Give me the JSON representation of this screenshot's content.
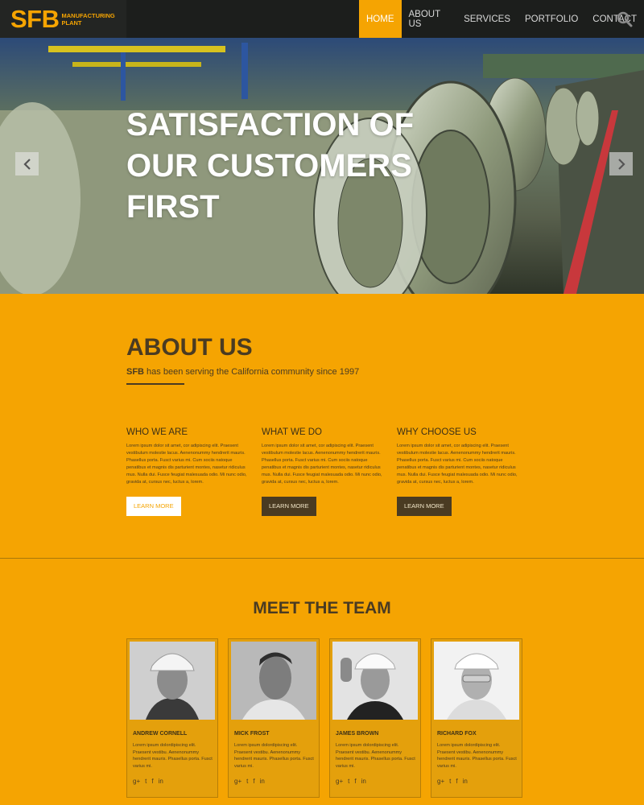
{
  "brand": {
    "logo_main": "SFB",
    "logo_sub": "MANUFACTURING PLANT",
    "accent": "#f5a402",
    "dark": "#1c1e1c",
    "text_brown": "#4a3b22"
  },
  "nav": {
    "items": [
      {
        "label": "HOME",
        "active": true
      },
      {
        "label": "ABOUT US",
        "active": false
      },
      {
        "label": "SERVICES",
        "active": false
      },
      {
        "label": "PORTFOLIO",
        "active": false
      },
      {
        "label": "CONTACT",
        "active": false
      }
    ],
    "search_icon": "search-icon"
  },
  "hero": {
    "title": "SATISFACTION OF OUR CUSTOMERS FIRST",
    "prev_icon": "chevron-left-icon",
    "next_icon": "chevron-right-icon"
  },
  "about": {
    "title": "ABOUT US",
    "subtitle_brand": "SFB",
    "subtitle_rest": " has been serving the California community since 1997",
    "columns": [
      {
        "heading": "WHO WE ARE",
        "body": "Lorem ipsum dolor sit amet, cor adipiscing elit. Praesent vestibulum molestie lacus. Aenenonummy hendrerit mauris. Phasellus porta. Fusct varius mi. Cum sociis natoque penatibus et magnis dis parturient montes, nasetur ridiculus mus. Nulla dui. Fusce feugiat malesuada odio. Mi nunc odio, gravida at, cursus nec, luctus a, lorem.",
        "button": "LEARN MORE",
        "style": "light"
      },
      {
        "heading": "WHAT WE DO",
        "body": "Lorem ipsum dolor sit amet, cor adipiscing elit. Praesent vestibulum molestie lacus. Aenenonummy hendrerit mauris. Phasellus porta. Fusct varius mi. Cum sociis natoque penatibus et magnis dis parturient montes, nasetur ridiculus mus. Nulla dui. Fusce feugiat malesuada odio. Mi nunc odio, gravida at, cursus nec, luctus a, lorem.",
        "button": "LEARN MORE",
        "style": "dark"
      },
      {
        "heading": "WHY CHOOSE US",
        "body": "Lorem ipsum dolor sit amet, cor adipiscing elit. Praesent vestibulum molestie lacus. Aenenonummy hendrerit mauris. Phasellus porta. Fusct varius mi. Cum sociis natoque penatibus et magnis dis parturient montes, nasetur ridiculus mus. Nulla dui. Fusce feugiat malesuada odio. Mi nunc odio, gravida at, cursus nec, luctus a, lorem.",
        "button": "LEARN MORE",
        "style": "dark"
      }
    ]
  },
  "team": {
    "title": "MEET THE TEAM",
    "members": [
      {
        "name": "ANDREW CORNELL",
        "bio": "Lorem ipsum dolordipiscing elit. Praesent vestibu. Aenenonummy hendrerit mauris. Phasellus porta. Fusct varius mi."
      },
      {
        "name": "MICK FROST",
        "bio": "Lorem ipsum dolordipiscing elit. Praesent vestibu. Aenenonummy hendrerit mauris. Phasellus porta. Fusct varius mi."
      },
      {
        "name": "JAMES BROWN",
        "bio": "Lorem ipsum dolordipiscing elit. Praesent vestibu. Aenenonummy hendrerit mauris. Phasellus porta. Fusct varius mi."
      },
      {
        "name": "RICHARD FOX",
        "bio": "Lorem ipsum dolordipiscing elit. Praesent vestibu. Aenenonummy hendrerit mauris. Phasellus porta. Fusct varius mi."
      }
    ],
    "social": {
      "google": "g+",
      "twitter": "t",
      "facebook": "f",
      "linkedin": "in"
    }
  }
}
